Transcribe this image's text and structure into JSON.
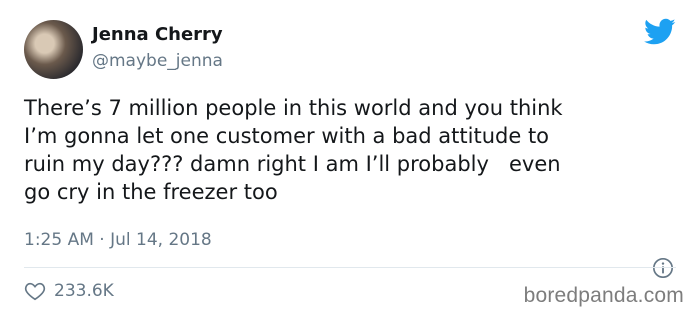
{
  "tweet": {
    "display_name": "Jenna Cherry",
    "handle": "@maybe_jenna",
    "text": "There’s 7 million people in this world and you think\nI’m gonna let one customer with a bad attitude to\nruin my day??? damn right I am I’ll probably   even\ngo cry in the freezer too",
    "timestamp": "1:25 AM · Jul 14, 2018",
    "likes": "233.6K"
  },
  "watermark": "boredpanda.com",
  "colors": {
    "twitter_blue": "#1DA1F2",
    "secondary_text": "#657786",
    "divider": "#E1E8ED"
  },
  "icons": {
    "brand": "twitter-bird-icon",
    "info": "info-icon",
    "like": "heart-icon"
  }
}
